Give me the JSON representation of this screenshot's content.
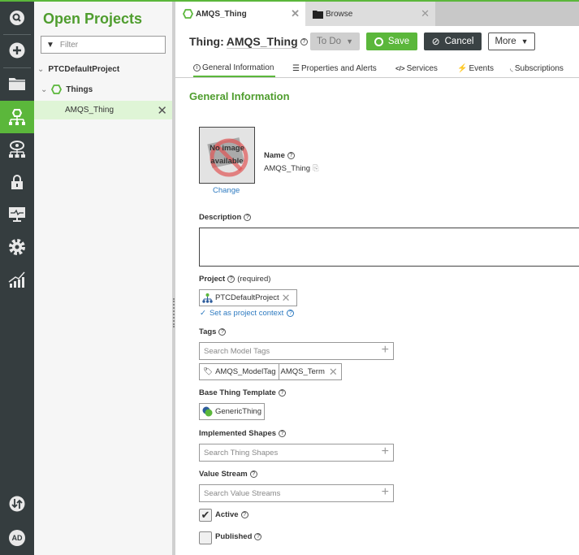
{
  "rail": {
    "items": [
      "search",
      "add",
      "folder",
      "modeling",
      "monitoring",
      "security",
      "system-monitor",
      "settings",
      "analytics",
      "import-export",
      "user"
    ],
    "user_initials": "AD"
  },
  "sidebar": {
    "title": "Open Projects",
    "filter_placeholder": "Filter",
    "project": "PTCDefaultProject",
    "group": "Things",
    "item": "AMQS_Thing"
  },
  "tabs": [
    {
      "label": "AMQS_Thing"
    },
    {
      "label": "Browse"
    }
  ],
  "header": {
    "prefix": "Thing:",
    "name": "AMQS_Thing",
    "todo": "To Do",
    "save": "Save",
    "cancel": "Cancel",
    "more": "More"
  },
  "subtabs": [
    "General Information",
    "Properties and Alerts",
    "Services",
    "Events",
    "Subscriptions"
  ],
  "form": {
    "section": "General Information",
    "image_text": "No image available",
    "change": "Change",
    "name_label": "Name",
    "name_value": "AMQS_Thing",
    "description_label": "Description",
    "description_value": "",
    "project_label": "Project",
    "project_required": "(required)",
    "project_value": "PTCDefaultProject",
    "project_context": "Set as project context",
    "tags_label": "Tags",
    "tags_placeholder": "Search Model Tags",
    "tag_vocab": "AMQS_ModelTag",
    "tag_term": "AMQS_Term",
    "template_label": "Base Thing Template",
    "template_value": "GenericThing",
    "shapes_label": "Implemented Shapes",
    "shapes_placeholder": "Search Thing Shapes",
    "stream_label": "Value Stream",
    "stream_placeholder": "Search Value Streams",
    "active_label": "Active",
    "active": true,
    "published_label": "Published",
    "published": false
  },
  "colors": {
    "accent": "#5bb73b",
    "rail": "#353d3f",
    "cancel": "#3a4244"
  }
}
